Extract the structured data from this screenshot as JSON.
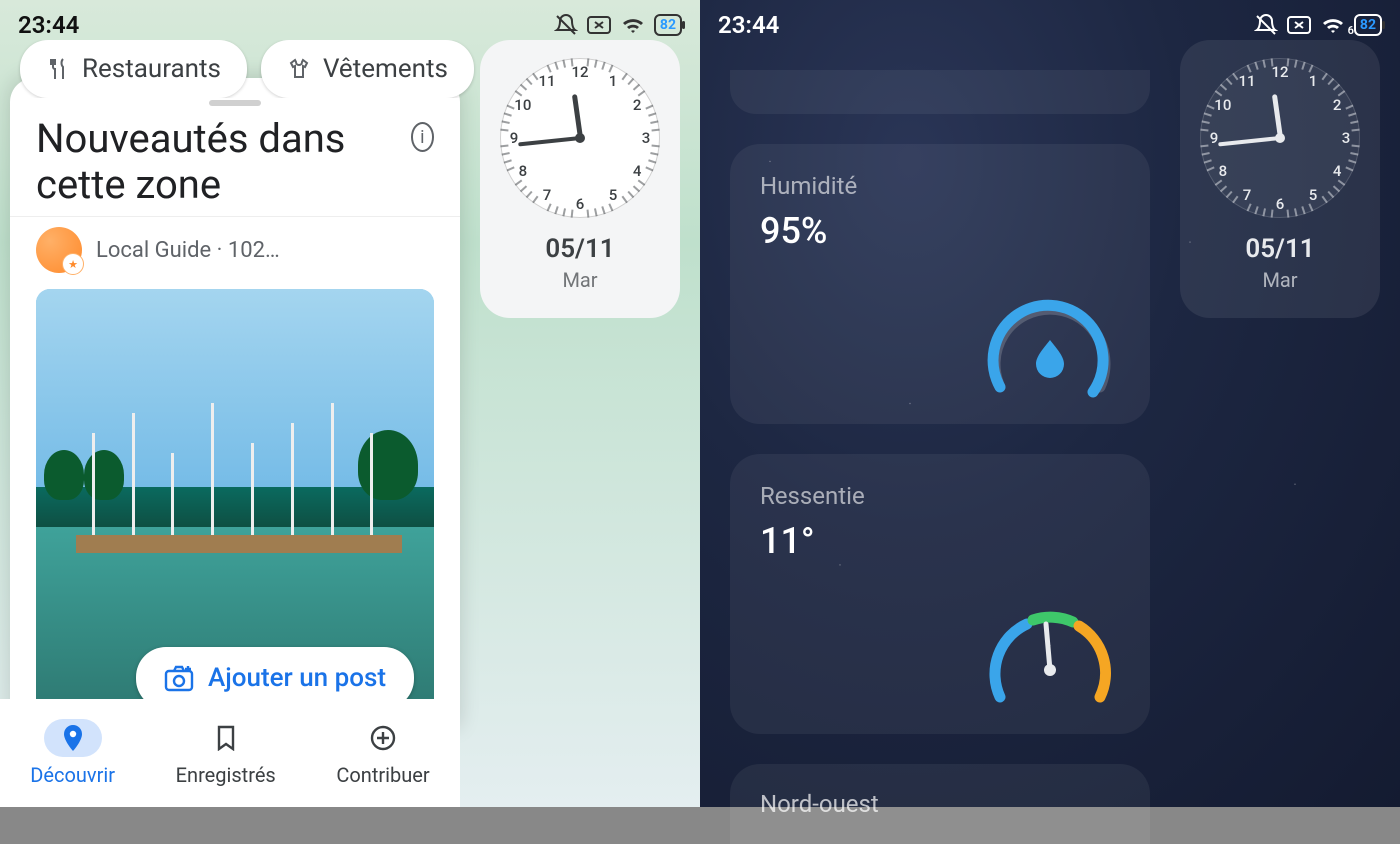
{
  "left": {
    "statusbar": {
      "time": "23:44",
      "battery": "82"
    },
    "chips": [
      {
        "icon": "fork-knife",
        "label": "Restaurants"
      },
      {
        "icon": "tshirt",
        "label": "Vêtements"
      }
    ],
    "sheet": {
      "title": "Nouveautés dans cette zone",
      "author_line": "Local Guide · 102…",
      "add_post_label": "Ajouter un post"
    },
    "bottomnav": [
      {
        "icon": "pin",
        "label": "Découvrir",
        "active": true
      },
      {
        "icon": "bookmark",
        "label": "Enregistrés",
        "active": false
      },
      {
        "icon": "plus-circle",
        "label": "Contribuer",
        "active": false
      }
    ]
  },
  "right": {
    "statusbar": {
      "time": "23:44",
      "battery": "82",
      "wifi_label": "6"
    },
    "cards": {
      "humidity": {
        "label": "Humidité",
        "value": "95%",
        "gauge_pct": 95
      },
      "feels": {
        "label": "Ressentie",
        "value": "11°"
      },
      "wind": {
        "label": "Nord-ouest"
      }
    }
  },
  "clock": {
    "hour": 11,
    "minute": 44,
    "date": "05/11",
    "day": "Mar"
  }
}
